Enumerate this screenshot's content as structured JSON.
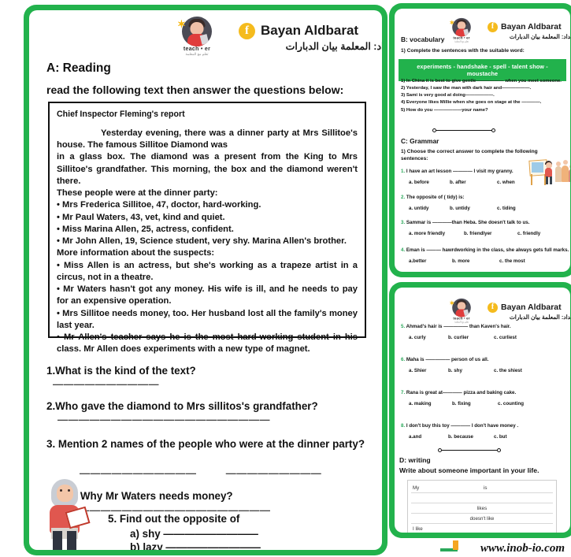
{
  "header": {
    "teacher_logo_text": "teach • er",
    "teacher_logo_sub": "تعلم مع المعلمة",
    "facebook_icon": "facebook-icon",
    "name": "Bayan Aldbarat",
    "arabic": "إعداد: المعلمة بيان الدبارات"
  },
  "reading": {
    "section_label": "A: Reading",
    "instruction": "read the following text then answer the questions below:",
    "passage": {
      "title": "Chief Inspector Fleming's report",
      "para1": "Yesterday evening, there was a dinner party at Mrs Sillitoe's house. The famous Sillitoe Diamond was",
      "para2": "in a glass box. The diamond was a present from the King to Mrs Sillitoe's grandfather. This morning, the box and the diamond weren't there.",
      "list_intro": "These people were at the dinner party:",
      "guests": [
        "• Mrs Frederica Sillitoe, 47, doctor, hard-working.",
        "• Mr Paul Waters, 43, vet, kind and quiet.",
        "• Miss Marina Allen, 25, actress, confident.",
        "• Mr John Allen, 19, Science student, very shy. Marina Allen's brother."
      ],
      "suspects_intro": "More information about the suspects:",
      "suspects": [
        "• Miss Allen is an actress, but she's working as a trapeze artist in a circus, not in a theatre.",
        "• Mr Waters hasn't got any money. His wife is ill, and he needs to pay for an expensive operation.",
        "• Mrs Sillitoe needs money, too. Her husband lost all the family's money last year.",
        "• Mr Allen's teacher says he is the most hard-working student in his class. Mr Allen does experiments with a new type of magnet."
      ]
    },
    "questions": [
      {
        "text": "1.What is the kind of the text?",
        "answer_line": "——————————"
      },
      {
        "text": "2.Who gave the diamond to Mrs sillitos's grandfather?",
        "answer_line": "————————————————————"
      },
      {
        "text": "3. Mention 2 names of the people who were at the dinner party?",
        "answer_line_1": "———————————",
        "answer_line_2": "—————————"
      },
      {
        "text": "4. Why Mr Waters needs money?",
        "answer_line": "———————————————————"
      },
      {
        "text": "5. Find out the opposite of",
        "sub_a": "a) shy —————————",
        "sub_b": "b) lazy —————————"
      }
    ]
  },
  "vocabulary": {
    "section_label": "B: vocabulary",
    "instruction": "1) Complete the sentences with the suitable word:",
    "word_bank": "experiments - handshake - spell - talent show - moustache",
    "items": [
      "1) In China it is best to give gentle—————— when you meet someone.",
      "2) Yesterday, I saw the man with dark hair and——————.",
      "3) Sami is very good at doing——————.",
      "4) Everyone likes Millie when she goes on stage at the ————.",
      "5) How do you ——————your name?"
    ]
  },
  "grammar": {
    "section_label": "C: Grammar",
    "instruction": "1) Choose the correct answer to complete the following sentences:",
    "questions": [
      {
        "num": "1.",
        "text": "I have  an art lesson ———— I visit my granny.",
        "options": [
          "a. before",
          "b. after",
          "c. when"
        ]
      },
      {
        "num": "2.",
        "text": "The opposite of ( tidy) is:",
        "options": [
          "a. untidy",
          "b. untidy",
          "c. tiding"
        ]
      },
      {
        "num": "3.",
        "text": "Sammar  is ————than Heba. She doesn't talk to us.",
        "options": [
          "a. more friendly",
          "b. friendlyer",
          "c. friendly"
        ]
      },
      {
        "num": "4.",
        "text": "Eman is ——— hawrdworking in the class, she always gets full marks.",
        "options": [
          "a.better",
          "b. more",
          "c. the most"
        ]
      },
      {
        "num": "5.",
        "text": "Ahmad's hair is ————— than Kaven's hair.",
        "options": [
          "a. curly",
          "b. curlier",
          "c. curliest"
        ]
      },
      {
        "num": "6.",
        "text": "Maha is ————— person of us all.",
        "options": [
          "a. Shier",
          "b. shy",
          "c. the shiest"
        ]
      },
      {
        "num": "7.",
        "text": "Rana  is great at———— pizza and baking cake.",
        "options": [
          "a. making",
          "b. fixing",
          "c. counting"
        ]
      },
      {
        "num": "8.",
        "text": "I don't buy this toy ———— I don't have money .",
        "options": [
          "a.and",
          "b. because",
          "c. but"
        ]
      }
    ]
  },
  "writing": {
    "section_label": "D: writing",
    "instruction": "Write about someone important in your life.",
    "lines": [
      {
        "left": "My",
        "center": "is"
      },
      {
        "left": "",
        "center": ""
      },
      {
        "left": "",
        "center": "likes"
      },
      {
        "left": "",
        "center": "doesn't like"
      },
      {
        "left": "I like",
        "center": ""
      }
    ]
  },
  "watermark": "www.inob-io.com",
  "colors": {
    "frame_green": "#22b24c",
    "accent_green": "#2aa85a",
    "fb_yellow": "#f5bb1d"
  }
}
